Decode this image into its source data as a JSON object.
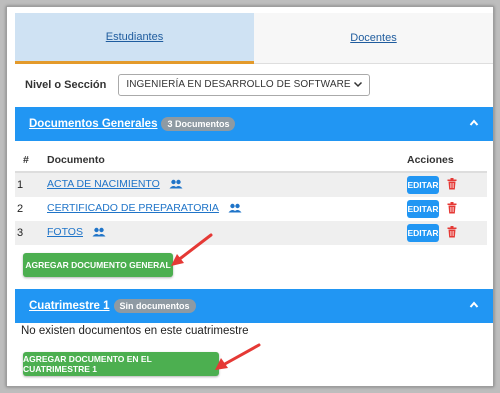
{
  "tabs": [
    {
      "label": "Estudiantes"
    },
    {
      "label": "Docentes"
    }
  ],
  "filter": {
    "label": "Nivel o Sección",
    "selected": "INGENIERÍA EN DESARROLLO DE SOFTWARE"
  },
  "general": {
    "title": "Documentos Generales",
    "badge": "3 Documentos",
    "columns": {
      "num": "#",
      "doc": "Documento",
      "actions": "Acciones"
    },
    "rows": [
      {
        "num": "1",
        "doc": "ACTA DE NACIMIENTO",
        "edit": "EDITAR"
      },
      {
        "num": "2",
        "doc": "CERTIFICADO DE PREPARATORIA",
        "edit": "EDITAR"
      },
      {
        "num": "3",
        "doc": "FOTOS",
        "edit": "EDITAR"
      }
    ],
    "add_button": "AGREGAR DOCUMENTO GENERAL"
  },
  "cuatrimestre": {
    "title": "Cuatrimestre 1",
    "badge": "Sin documentos",
    "empty_text": "No existen documentos en este cuatrimestre",
    "add_button": "AGREGAR DOCUMENTO EN EL CUATRIMESTRE 1"
  },
  "colors": {
    "accent": "#2196f3",
    "tab_active": "#cfe2f3",
    "green": "#4caf50",
    "danger": "#e53935",
    "arrow": "#e53935"
  },
  "icons": [
    "chevron-down-icon",
    "chevron-up-icon",
    "group-icon",
    "trash-icon",
    "arrow-icon"
  ]
}
